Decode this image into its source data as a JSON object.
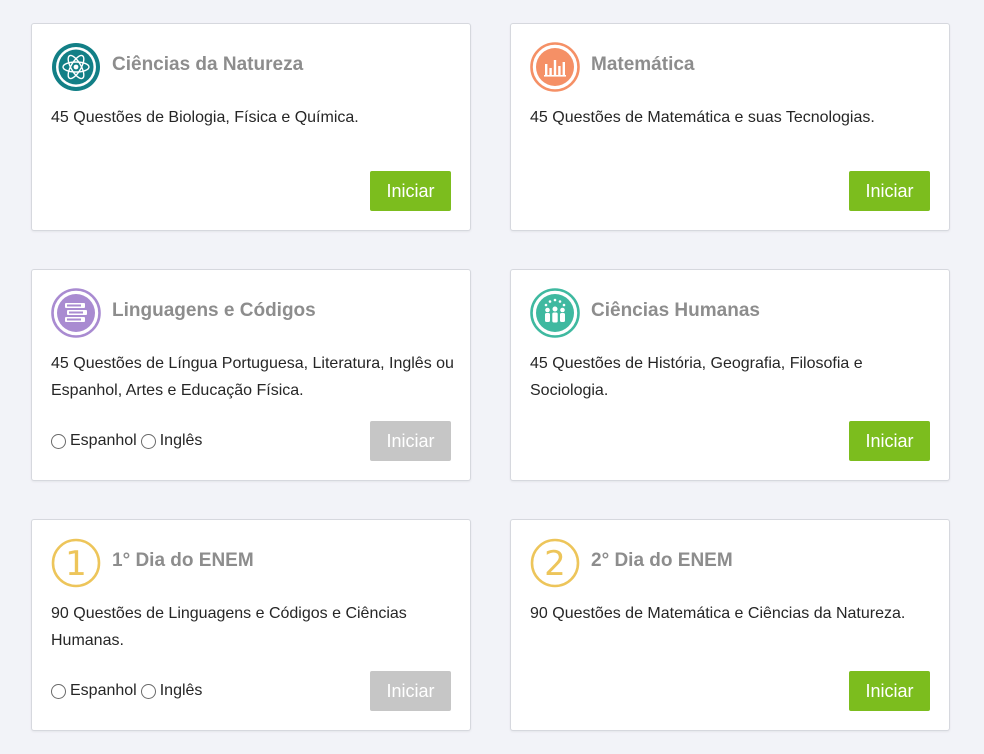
{
  "cards": [
    {
      "title": "Ciências da Natureza",
      "description": "45 Questões de Biologia, Física e Química.",
      "button": "Iniciar",
      "button_enabled": true,
      "icon": "atom-icon",
      "color": "#127f86"
    },
    {
      "title": "Matemática",
      "description": "45 Questões de Matemática e suas Tecnologias.",
      "button": "Iniciar",
      "button_enabled": true,
      "icon": "bar-chart-icon",
      "color": "#f59066"
    },
    {
      "title": "Linguagens e Códigos",
      "description": "45 Questões de Língua Portuguesa, Literatura, Inglês ou Espanhol, Artes e Educação Física.",
      "button": "Iniciar",
      "button_enabled": false,
      "icon": "books-icon",
      "color": "#a98bd1",
      "options": [
        "Espanhol",
        "Inglês"
      ]
    },
    {
      "title": "Ciências Humanas",
      "description": "45 Questões de História, Geografia, Filosofia e Sociologia.",
      "button": "Iniciar",
      "button_enabled": true,
      "icon": "people-icon",
      "color": "#3fb9a0"
    },
    {
      "title": "1° Dia do ENEM",
      "description": "90 Questões de Linguagens e Códigos e Ciências Humanas.",
      "button": "Iniciar",
      "button_enabled": false,
      "icon": "number-one-icon",
      "color": "#edc55a",
      "options": [
        "Espanhol",
        "Inglês"
      ]
    },
    {
      "title": "2° Dia do ENEM",
      "description": "90 Questões de Matemática e Ciências da Natureza.",
      "button": "Iniciar",
      "button_enabled": true,
      "icon": "number-two-icon",
      "color": "#edc55a"
    }
  ],
  "colors": {
    "button_active": "#7cbd1e",
    "button_disabled": "#c6c6c6",
    "title_text": "#8d8d8d",
    "background": "#f2f3f8"
  }
}
